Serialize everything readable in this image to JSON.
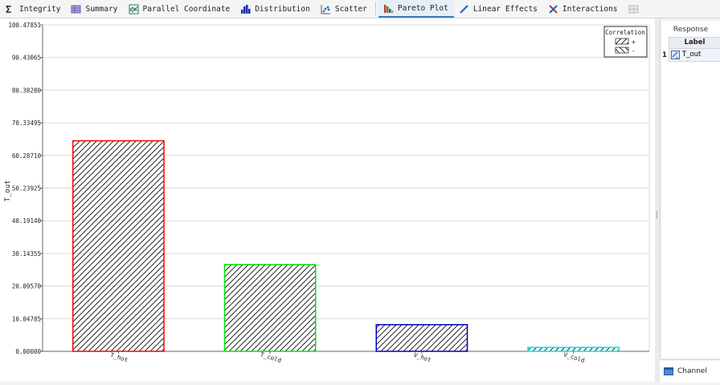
{
  "toolbar": {
    "tabs": [
      {
        "label": "Integrity",
        "icon": "sigma-icon"
      },
      {
        "label": "Summary",
        "icon": "table-icon"
      },
      {
        "label": "Parallel Coordinate",
        "icon": "parallel-coordinate-icon"
      },
      {
        "label": "Distribution",
        "icon": "histogram-icon"
      },
      {
        "label": "Scatter",
        "icon": "scatter-icon"
      },
      {
        "label": "Pareto Plot",
        "icon": "pareto-icon",
        "active": true
      },
      {
        "label": "Linear Effects",
        "icon": "line-icon"
      },
      {
        "label": "Interactions",
        "icon": "interactions-icon"
      }
    ]
  },
  "chart_data": {
    "type": "bar",
    "categories": [
      "T_hot",
      "T_cold",
      "V_hot",
      "V_cold"
    ],
    "values": [
      64.8,
      26.7,
      8.2,
      1.2
    ],
    "colors": [
      "#ff0000",
      "#00e600",
      "#0000cc",
      "#00e5e5"
    ],
    "correlation": [
      "+",
      "+",
      "+",
      "+"
    ],
    "ylabel": "T_out",
    "xlabel": "",
    "ylim": [
      0,
      100.47851
    ],
    "yticks": [
      "0.00000",
      "10.04785",
      "20.09570",
      "30.14355",
      "40.19140",
      "50.23925",
      "60.28710",
      "70.33495",
      "80.38280",
      "90.43065",
      "100.47851"
    ],
    "grid": true,
    "legend": {
      "title": "Correlation",
      "entries": [
        "+",
        "-"
      ],
      "placement": "top-right"
    }
  },
  "response": {
    "title": "Response",
    "column_header": "Label",
    "rows": [
      {
        "index": "1",
        "label": "T_out"
      }
    ]
  },
  "channel": {
    "label": "Channel"
  }
}
